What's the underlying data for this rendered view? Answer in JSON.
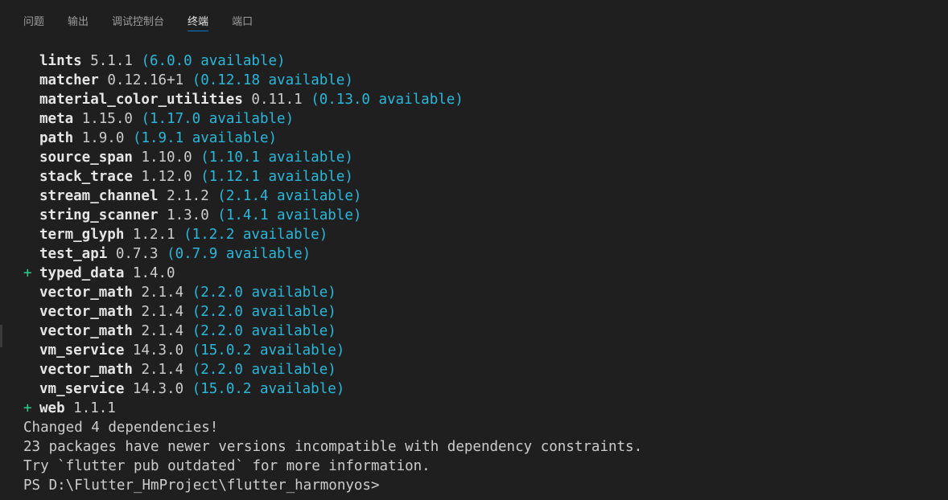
{
  "tabs": [
    {
      "label": "问题",
      "active": false
    },
    {
      "label": "输出",
      "active": false
    },
    {
      "label": "调试控制台",
      "active": false
    },
    {
      "label": "终端",
      "active": true
    },
    {
      "label": "端口",
      "active": false
    }
  ],
  "colors": {
    "background": "#1f1f1f",
    "text": "#cccccc",
    "available": "#29b8db",
    "added_marker": "#23d18b",
    "active_tab_underline": "#0078d4"
  },
  "terminal": {
    "packages": [
      {
        "prefix": " ",
        "name": "lints",
        "version": "5.1.1",
        "available": "(6.0.0 available)"
      },
      {
        "prefix": " ",
        "name": "matcher",
        "version": "0.12.16+1",
        "available": "(0.12.18 available)"
      },
      {
        "prefix": " ",
        "name": "material_color_utilities",
        "version": "0.11.1",
        "available": "(0.13.0 available)"
      },
      {
        "prefix": " ",
        "name": "meta",
        "version": "1.15.0",
        "available": "(1.17.0 available)"
      },
      {
        "prefix": " ",
        "name": "path",
        "version": "1.9.0",
        "available": "(1.9.1 available)"
      },
      {
        "prefix": " ",
        "name": "source_span",
        "version": "1.10.0",
        "available": "(1.10.1 available)"
      },
      {
        "prefix": " ",
        "name": "stack_trace",
        "version": "1.12.0",
        "available": "(1.12.1 available)"
      },
      {
        "prefix": " ",
        "name": "stream_channel",
        "version": "2.1.2",
        "available": "(2.1.4 available)"
      },
      {
        "prefix": " ",
        "name": "string_scanner",
        "version": "1.3.0",
        "available": "(1.4.1 available)"
      },
      {
        "prefix": " ",
        "name": "term_glyph",
        "version": "1.2.1",
        "available": "(1.2.2 available)"
      },
      {
        "prefix": " ",
        "name": "test_api",
        "version": "0.7.3",
        "available": "(0.7.9 available)"
      },
      {
        "prefix": "+",
        "name": "typed_data",
        "version": "1.4.0",
        "available": ""
      },
      {
        "prefix": " ",
        "name": "vector_math",
        "version": "2.1.4",
        "available": "(2.2.0 available)"
      },
      {
        "prefix": " ",
        "name": "vector_math",
        "version": "2.1.4",
        "available": "(2.2.0 available)"
      },
      {
        "prefix": " ",
        "name": "vector_math",
        "version": "2.1.4",
        "available": "(2.2.0 available)"
      },
      {
        "prefix": " ",
        "name": "vm_service",
        "version": "14.3.0",
        "available": "(15.0.2 available)"
      },
      {
        "prefix": " ",
        "name": "vector_math",
        "version": "2.1.4",
        "available": "(2.2.0 available)"
      },
      {
        "prefix": " ",
        "name": "vm_service",
        "version": "14.3.0",
        "available": "(15.0.2 available)"
      },
      {
        "prefix": "+",
        "name": "web",
        "version": "1.1.1",
        "available": ""
      }
    ],
    "summary_lines": [
      "Changed 4 dependencies!",
      "23 packages have newer versions incompatible with dependency constraints.",
      "Try `flutter pub outdated` for more information.",
      "PS D:\\Flutter_HmProject\\flutter_harmonyos>"
    ]
  }
}
